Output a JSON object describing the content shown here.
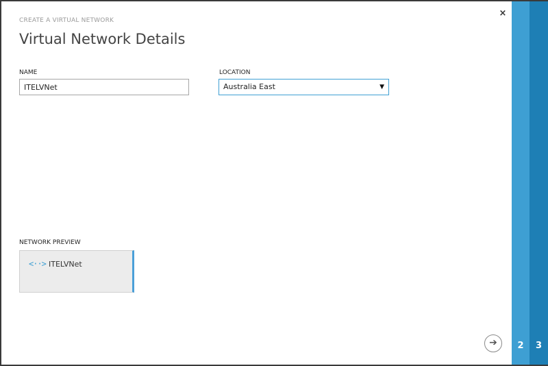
{
  "header": {
    "subtitle": "CREATE A VIRTUAL NETWORK",
    "title": "Virtual Network Details",
    "close_icon": "×"
  },
  "form": {
    "name_label": "NAME",
    "name_value": "ITELVNet",
    "location_label": "LOCATION",
    "location_value": "Australia East",
    "location_arrow": "▼"
  },
  "preview": {
    "label": "NETWORK PREVIEW",
    "icon": "<··>",
    "name": "ITELVNet"
  },
  "footer": {
    "next_icon": "➔"
  },
  "steps": [
    "2",
    "3"
  ],
  "colors": {
    "accent": "#3e9fd3",
    "accent_dark": "#1e7fb5"
  }
}
